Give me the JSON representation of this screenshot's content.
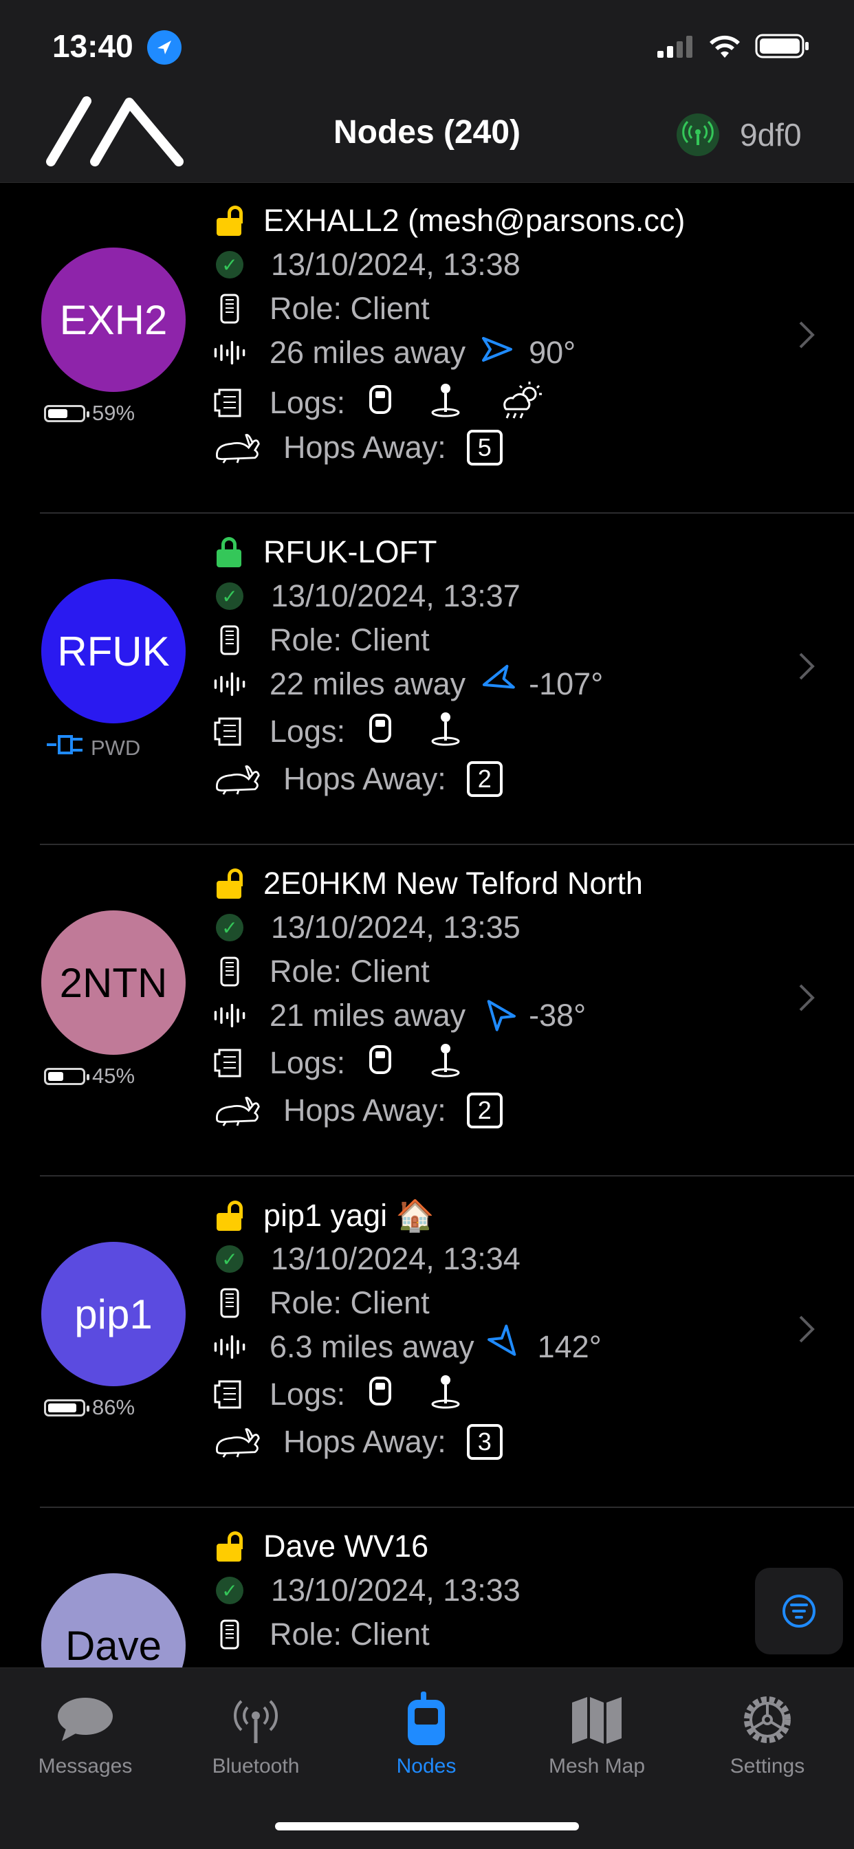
{
  "status_bar": {
    "time": "13:40"
  },
  "header": {
    "title": "Nodes (240)",
    "connected_node_id": "9df0"
  },
  "nodes": [
    {
      "name": "EXHALL2 (mesh@parsons.cc)",
      "short_name": "EXH2",
      "avatar_color": "#8e24aa",
      "avatar_text_color": "#ffffff",
      "lock": "unlocked",
      "battery_label": "59%",
      "battery_level": 0.59,
      "last_heard": "13/10/2024, 13:38",
      "role": "Role: Client",
      "distance": "26 miles away",
      "heading": "90°",
      "logs_label": "Logs:",
      "logs": [
        "device-metrics",
        "positions",
        "environment"
      ],
      "hops_label": "Hops Away:",
      "hops": "5"
    },
    {
      "name": "RFUK-LOFT",
      "short_name": "RFUK",
      "avatar_color": "#2a1af0",
      "avatar_text_color": "#ffffff",
      "lock": "locked",
      "power_label": "PWD",
      "last_heard": "13/10/2024, 13:37",
      "role": "Role: Client",
      "distance": "22 miles away",
      "heading": "-107°",
      "logs_label": "Logs:",
      "logs": [
        "device-metrics",
        "positions"
      ],
      "hops_label": "Hops Away:",
      "hops": "2"
    },
    {
      "name": "2E0HKM New Telford North",
      "short_name": "2NTN",
      "avatar_color": "#c07a98",
      "avatar_text_color": "#000000",
      "lock": "unlocked",
      "battery_label": "45%",
      "battery_level": 0.45,
      "last_heard": "13/10/2024, 13:35",
      "role": "Role: Client",
      "distance": "21 miles away",
      "heading": "-38°",
      "logs_label": "Logs:",
      "logs": [
        "device-metrics",
        "positions"
      ],
      "hops_label": "Hops Away:",
      "hops": "2"
    },
    {
      "name": "pip1 yagi 🏠",
      "short_name": "pip1",
      "avatar_color": "#5b4be0",
      "avatar_text_color": "#ffffff",
      "lock": "unlocked",
      "battery_label": "86%",
      "battery_level": 0.86,
      "last_heard": "13/10/2024, 13:34",
      "role": "Role: Client",
      "distance": "6.3 miles away",
      "heading": "142°",
      "logs_label": "Logs:",
      "logs": [
        "device-metrics",
        "positions"
      ],
      "hops_label": "Hops Away:",
      "hops": "3"
    },
    {
      "name": "Dave WV16",
      "short_name": "Dave",
      "avatar_color": "#9a98d0",
      "avatar_text_color": "#000000",
      "lock": "unlocked",
      "last_heard": "13/10/2024, 13:33",
      "role": "Role: Client"
    }
  ],
  "tabs": [
    {
      "label": "Messages",
      "icon": "speech-bubble-icon",
      "active": false
    },
    {
      "label": "Bluetooth",
      "icon": "antenna-icon",
      "active": false
    },
    {
      "label": "Nodes",
      "icon": "radio-device-icon",
      "active": true
    },
    {
      "label": "Mesh Map",
      "icon": "map-icon",
      "active": false
    },
    {
      "label": "Settings",
      "icon": "gear-icon",
      "active": false
    }
  ],
  "colors": {
    "accent": "#1f8bff",
    "lock_open": "#ffcc00",
    "lock_closed": "#34c759",
    "check": "#34c759"
  }
}
